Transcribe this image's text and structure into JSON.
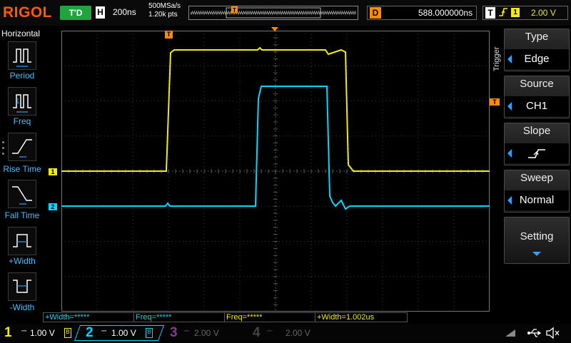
{
  "brand": "RIGOL",
  "status": "T'D",
  "timebase": {
    "label": "H",
    "value": "200ns"
  },
  "acquisition": {
    "rate": "500MSa/s",
    "points": "1.20k pts"
  },
  "delay": {
    "label": "D",
    "value": "588.000000ns"
  },
  "trigger_status": {
    "label": "T",
    "source": "1",
    "level": "2.00 V"
  },
  "horizontal_menu": {
    "title": "Horizontal",
    "items": [
      {
        "label": "Period"
      },
      {
        "label": "Freq"
      },
      {
        "label": "Rise Time"
      },
      {
        "label": "Fall Time"
      },
      {
        "label": "+Width"
      },
      {
        "label": "-Width"
      }
    ]
  },
  "trigger_menu": {
    "title": "Trigger",
    "items": [
      {
        "title": "Type",
        "value": "Edge"
      },
      {
        "title": "Source",
        "value": "CH1"
      },
      {
        "title": "Slope",
        "value": ""
      },
      {
        "title": "Sweep",
        "value": "Normal"
      },
      {
        "title": "Setting",
        "value": ""
      }
    ]
  },
  "markers": {
    "ch1": "1",
    "ch2": "2",
    "trigger": "T"
  },
  "measurements": [
    {
      "text": "+Width=*****",
      "color": "#00d8ff"
    },
    {
      "text": "Freq=*****",
      "color": "#00d8ff"
    },
    {
      "text": "Freq=*****",
      "color": "#f2ea13"
    },
    {
      "text": "+Width=1.002us",
      "color": "#f2ea13"
    }
  ],
  "channels": [
    {
      "num": "1",
      "scale": "1.00 V",
      "color": "#f2ea13",
      "active": true
    },
    {
      "num": "2",
      "scale": "1.00 V",
      "color": "#00d8ff",
      "active": true
    },
    {
      "num": "3",
      "scale": "2.00 V",
      "color": "#8a3a8a",
      "active": false
    },
    {
      "num": "4",
      "scale": "2.00 V",
      "color": "#444444",
      "active": false
    }
  ],
  "colors": {
    "ch1": "#f2ea13",
    "ch2": "#00d8ff",
    "accent": "#ff8c00",
    "menu_blue": "#30a0ff"
  }
}
